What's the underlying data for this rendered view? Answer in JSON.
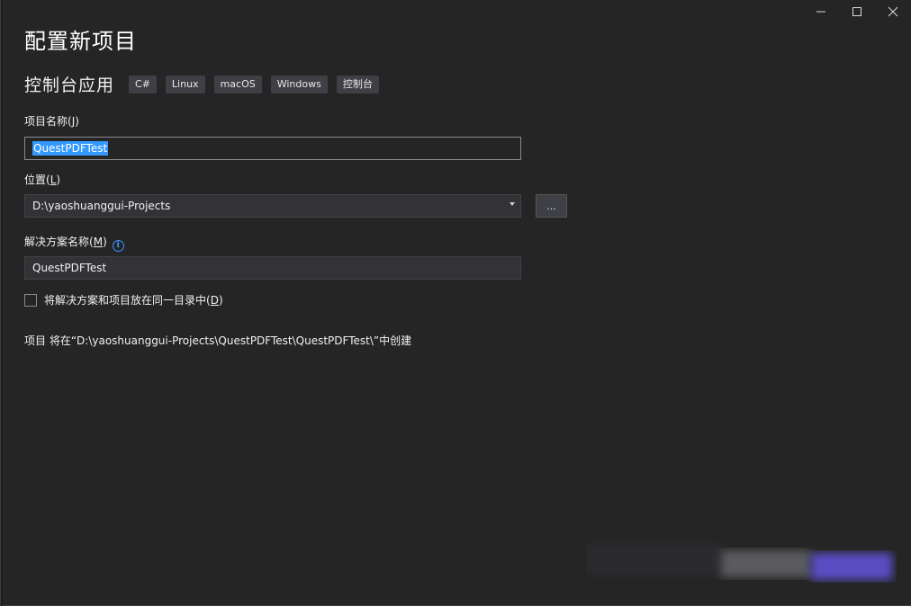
{
  "window": {
    "controls": {
      "minimize_icon": "—",
      "maximize_icon": "☐",
      "close_icon": "✕"
    }
  },
  "header": {
    "title": "配置新项目",
    "template_name": "控制台应用",
    "tags": [
      "C#",
      "Linux",
      "macOS",
      "Windows",
      "控制台"
    ]
  },
  "form": {
    "project_name": {
      "label": "项目名称",
      "accesskey": "J",
      "value": "QuestPDFTest"
    },
    "location": {
      "label": "位置",
      "accesskey": "L",
      "value": "D:\\yaoshuanggui-Projects",
      "browse_label": "..."
    },
    "solution_name": {
      "label": "解决方案名称",
      "accesskey": "M",
      "value": "QuestPDFTest"
    },
    "same_directory": {
      "label": "将解决方案和项目放在同一目录中",
      "accesskey": "D",
      "checked": false
    },
    "path_note": "项目 将在“D:\\yaoshuanggui-Projects\\QuestPDFTest\\QuestPDFTest\\”中创建"
  },
  "colors": {
    "background": "#252526",
    "input_background": "#333337",
    "selection": "#3399ff",
    "accent_info": "#3794ff",
    "tag_background": "#3f3f46"
  }
}
